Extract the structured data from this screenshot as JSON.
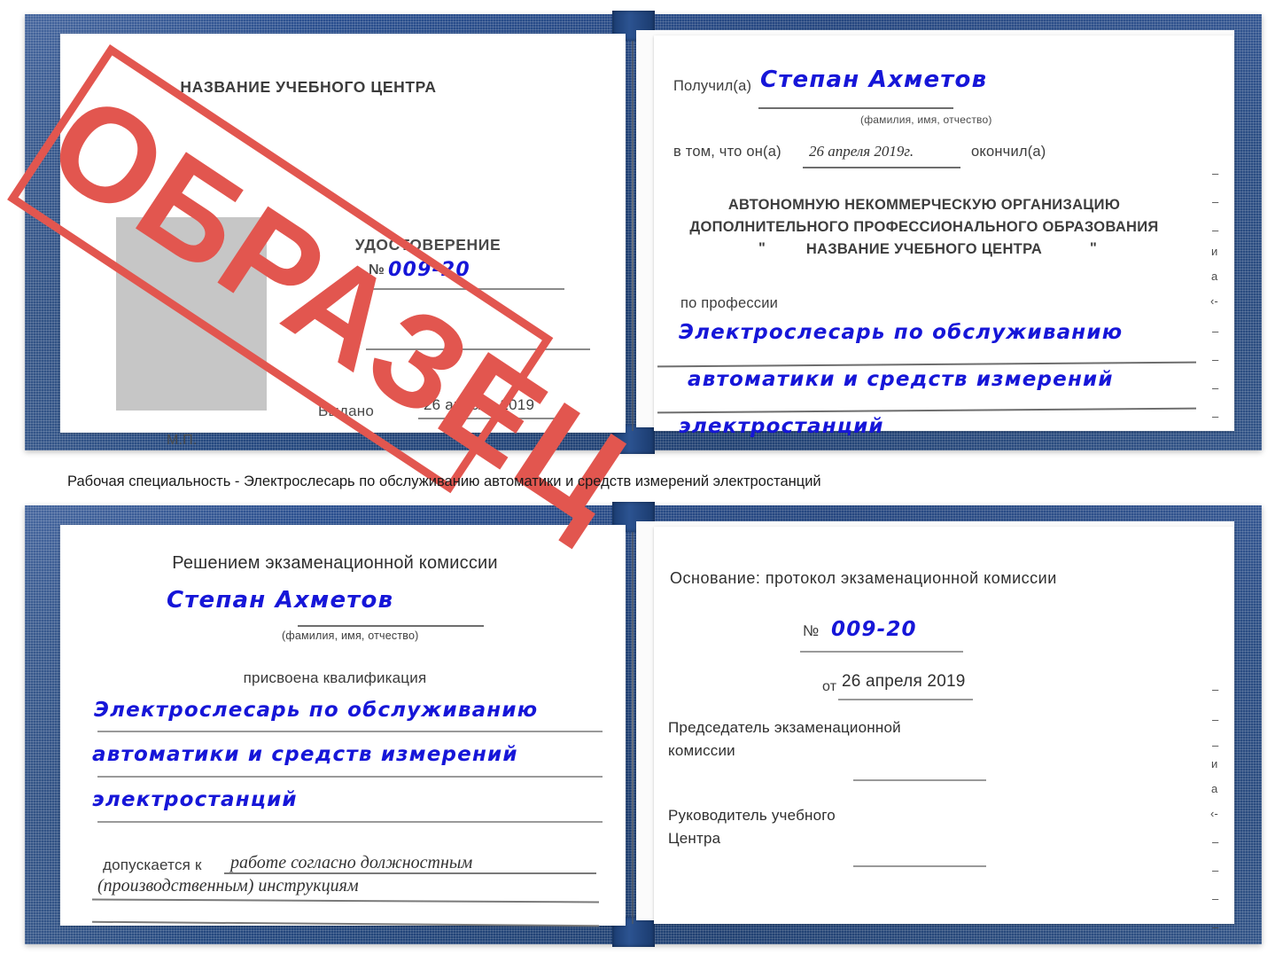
{
  "caption": {
    "text": "Рабочая специальность - Электрослесарь по обслуживанию автоматики и средств измерений электростанций"
  },
  "stamp": {
    "label": "ОБРАЗЕЦ",
    "color": "#e2564f"
  },
  "colors": {
    "cover_blue": "#20457f",
    "handwriting_blue": "#1616d8",
    "print_gray": "#3a3a3a",
    "photo_placeholder": "#c6c6c6",
    "rule_gray": "#8b8b8b"
  },
  "certificate_top": {
    "left_page": {
      "center_header": "НАЗВАНИЕ УЧЕБНОГО ЦЕНТРА",
      "doc_type": "УДОСТОВЕРЕНИЕ",
      "number_label": "№",
      "number_value": "009-20",
      "issued_label": "Выдано",
      "issued_value": "26 апреля 2019",
      "seal_label": "М.П.",
      "photo_placeholder_alt": "фотография"
    },
    "right_page": {
      "received_label": "Получил(а)",
      "received_value": "Степан Ахметов",
      "fio_hint": "(фамилия, имя, отчество)",
      "that_he_label": "в том, что он(а)",
      "completion_date": "26 апреля 2019г.",
      "finished_label": "окончил(а)",
      "org_line1": "АВТОНОМНУЮ НЕКОММЕРЧЕСКУЮ ОРГАНИЗАЦИЮ",
      "org_line2": "ДОПОЛНИТЕЛЬНОГО ПРОФЕССИОНАЛЬНОГО ОБРАЗОВАНИЯ",
      "org_quote_open": "\"",
      "org_line3": "НАЗВАНИЕ УЧЕБНОГО ЦЕНТРА",
      "org_quote_close": "\"",
      "profession_label": "по профессии",
      "profession_line1": "Электрослесарь по обслуживанию",
      "profession_line2": "автоматики и средств измерений",
      "profession_line3": "электростанций",
      "edge_marks": [
        "–",
        "–",
        "–",
        "и",
        "а",
        "‹-",
        "–",
        "–",
        "–",
        "–"
      ]
    }
  },
  "certificate_bottom": {
    "left_page": {
      "header": "Решением экзаменационной комиссии",
      "name_value": "Степан Ахметов",
      "fio_hint": "(фамилия, имя, отчество)",
      "qualification_label": "присвоена квалификация",
      "qualification_line1": "Электрослесарь по обслуживанию",
      "qualification_line2": "автоматики и средств измерений",
      "qualification_line3": "электростанций",
      "allowed_label": "допускается к",
      "allowed_value_line1": "работе согласно должностным",
      "allowed_value_line2": "(производственным) инструкциям"
    },
    "right_page": {
      "basis_label": "Основание: протокол экзаменационной комиссии",
      "number_label": "№",
      "number_value": "009-20",
      "date_label": "от",
      "date_value": "26 апреля 2019",
      "chairman_line1": "Председатель экзаменационной",
      "chairman_line2": "комиссии",
      "head_line1": "Руководитель учебного",
      "head_line2": "Центра",
      "edge_marks": [
        "–",
        "–",
        "–",
        "и",
        "а",
        "‹-",
        "–",
        "–",
        "–",
        "–"
      ]
    }
  }
}
